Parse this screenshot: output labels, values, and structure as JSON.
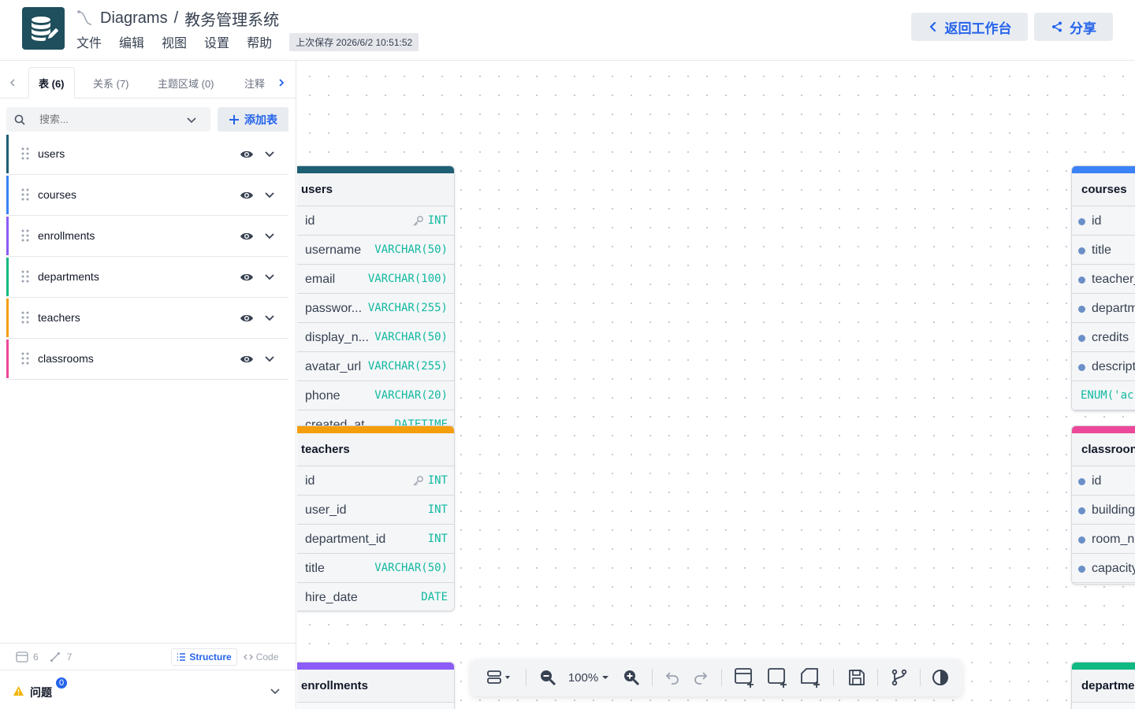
{
  "header": {
    "breadcrumb_root": "Diagrams",
    "breadcrumb_sep": "/",
    "diagram_name": "教务管理系统",
    "menu": [
      "文件",
      "编辑",
      "视图",
      "设置",
      "帮助"
    ],
    "last_saved": "上次保存 2026/6/2 10:51:52",
    "back_label": "返回工作台",
    "share_label": "分享"
  },
  "sidebar": {
    "tabs": [
      {
        "label": "表 (6)",
        "active": true
      },
      {
        "label": "关系 (7)",
        "active": false
      },
      {
        "label": "主题区域 (0)",
        "active": false
      },
      {
        "label": "注释",
        "active": false
      }
    ],
    "search_placeholder": "搜索...",
    "add_table_label": "添加表",
    "tables": [
      {
        "name": "users",
        "color": "#1f5f73"
      },
      {
        "name": "courses",
        "color": "#3b82f6"
      },
      {
        "name": "enrollments",
        "color": "#8b5cf6"
      },
      {
        "name": "departments",
        "color": "#10b981"
      },
      {
        "name": "teachers",
        "color": "#f59e0b"
      },
      {
        "name": "classrooms",
        "color": "#ec4899"
      }
    ],
    "footer": {
      "table_count": "6",
      "relation_count": "7",
      "structure_label": "Structure",
      "code_label": "Code"
    },
    "issues": {
      "label": "问题",
      "count": "0"
    }
  },
  "canvas": {
    "tables": [
      {
        "name": "users",
        "color": "#1f5f73",
        "fields": [
          {
            "name": "id",
            "type": "INT",
            "pk": true
          },
          {
            "name": "username",
            "type": "VARCHAR(50)"
          },
          {
            "name": "email",
            "type": "VARCHAR(100)"
          },
          {
            "name": "passwor...",
            "type": "VARCHAR(255)"
          },
          {
            "name": "display_n...",
            "type": "VARCHAR(50)"
          },
          {
            "name": "avatar_url",
            "type": "VARCHAR(255)"
          },
          {
            "name": "phone",
            "type": "VARCHAR(20)"
          },
          {
            "name": "created_at",
            "type": "DATETIME"
          }
        ]
      },
      {
        "name": "teachers",
        "color": "#f59e0b",
        "fields": [
          {
            "name": "id",
            "type": "INT",
            "pk": true
          },
          {
            "name": "user_id",
            "type": "INT"
          },
          {
            "name": "department_id",
            "type": "INT"
          },
          {
            "name": "title",
            "type": "VARCHAR(50)"
          },
          {
            "name": "hire_date",
            "type": "DATE"
          }
        ]
      },
      {
        "name": "enrollments",
        "color": "#8b5cf6",
        "fields": []
      },
      {
        "name": "courses",
        "color": "#3b82f6",
        "fields": [
          {
            "name": "id"
          },
          {
            "name": "title"
          },
          {
            "name": "teacher_"
          },
          {
            "name": "departm"
          },
          {
            "name": "credits"
          },
          {
            "name": "descript"
          }
        ],
        "extra": "ENUM('ac"
      },
      {
        "name": "classroon",
        "color": "#ec4899",
        "fields": [
          {
            "name": "id"
          },
          {
            "name": "building"
          },
          {
            "name": "room_n"
          },
          {
            "name": "capacity"
          }
        ]
      },
      {
        "name": "departme",
        "color": "#10b981",
        "fields": []
      }
    ]
  },
  "toolbar": {
    "zoom": "100%"
  }
}
